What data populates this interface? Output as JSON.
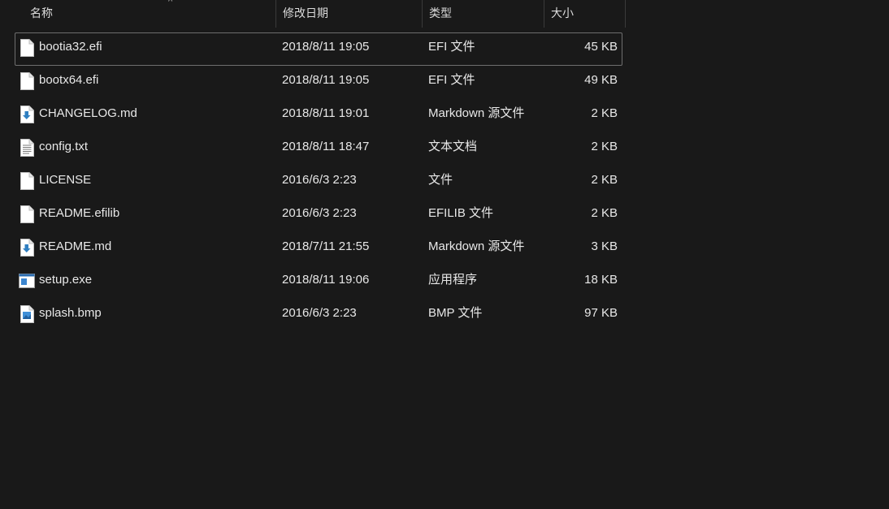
{
  "columns": {
    "name": "名称",
    "date": "修改日期",
    "type": "类型",
    "size": "大小"
  },
  "sort_indicator": "^",
  "files": [
    {
      "name": "bootia32.efi",
      "date": "2018/8/11 19:05",
      "type": "EFI 文件",
      "size": "45 KB",
      "icon": "blank-file-icon",
      "selected": true
    },
    {
      "name": "bootx64.efi",
      "date": "2018/8/11 19:05",
      "type": "EFI 文件",
      "size": "49 KB",
      "icon": "blank-file-icon",
      "selected": false
    },
    {
      "name": "CHANGELOG.md",
      "date": "2018/8/11 19:01",
      "type": "Markdown 源文件",
      "size": "2 KB",
      "icon": "markdown-file-icon",
      "selected": false
    },
    {
      "name": "config.txt",
      "date": "2018/8/11 18:47",
      "type": "文本文档",
      "size": "2 KB",
      "icon": "text-file-icon",
      "selected": false
    },
    {
      "name": "LICENSE",
      "date": "2016/6/3 2:23",
      "type": "文件",
      "size": "2 KB",
      "icon": "blank-file-icon",
      "selected": false
    },
    {
      "name": "README.efilib",
      "date": "2016/6/3 2:23",
      "type": "EFILIB 文件",
      "size": "2 KB",
      "icon": "blank-file-icon",
      "selected": false
    },
    {
      "name": "README.md",
      "date": "2018/7/11 21:55",
      "type": "Markdown 源文件",
      "size": "3 KB",
      "icon": "markdown-file-icon",
      "selected": false
    },
    {
      "name": "setup.exe",
      "date": "2018/8/11 19:06",
      "type": "应用程序",
      "size": "18 KB",
      "icon": "application-icon",
      "selected": false
    },
    {
      "name": "splash.bmp",
      "date": "2016/6/3 2:23",
      "type": "BMP 文件",
      "size": "97 KB",
      "icon": "image-file-icon",
      "selected": false
    }
  ],
  "colors": {
    "background": "#191919",
    "text": "#e8e8e8",
    "selection_border": "#6e6e6e",
    "markdown_accent": "#2f7fc1"
  }
}
